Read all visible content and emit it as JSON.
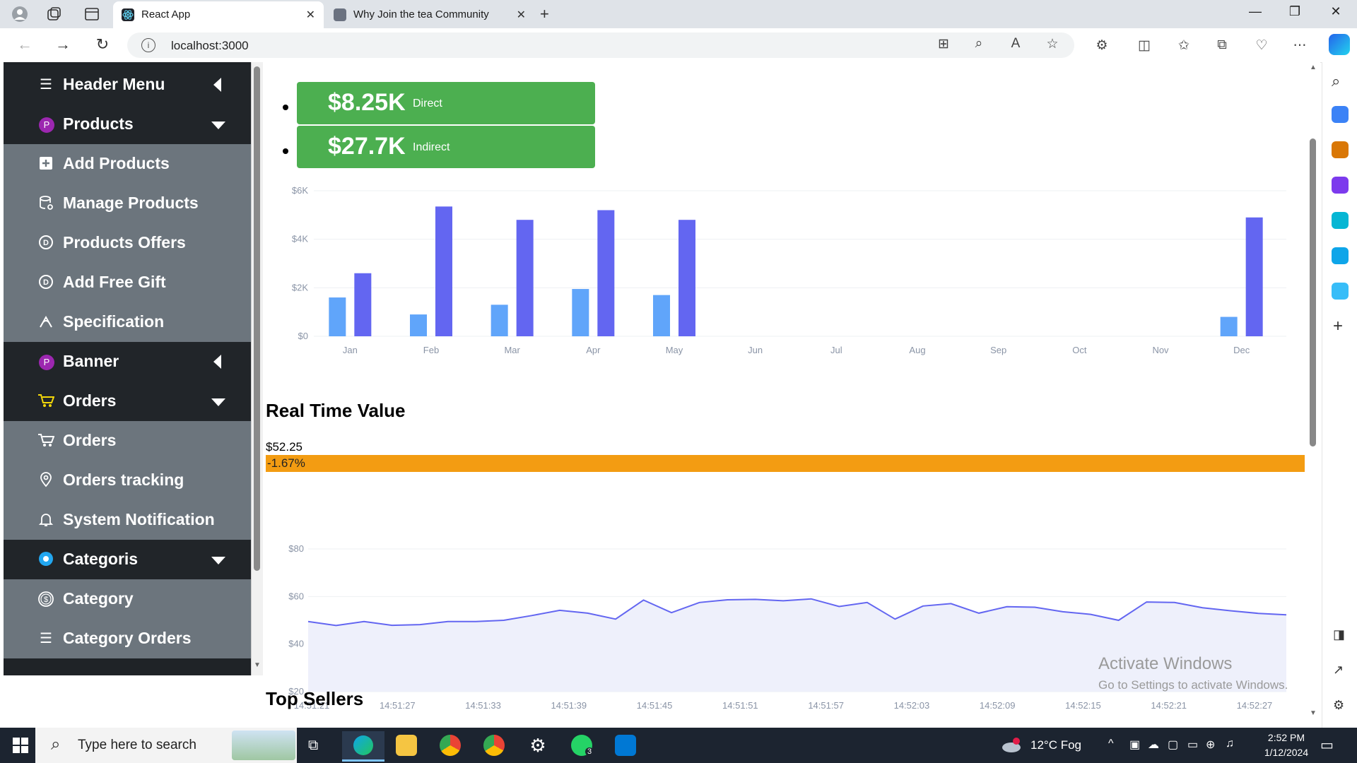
{
  "browser": {
    "tabs": [
      {
        "label": "React App",
        "active": true
      },
      {
        "label": "Why Join the tea Community",
        "active": false
      }
    ],
    "url": "localhost:3000"
  },
  "sidebar": {
    "header": "Header Menu",
    "sections": [
      {
        "label": "Products",
        "icon": "badge-p-icon",
        "expanded": true,
        "items": [
          {
            "label": "Add Products",
            "icon": "plus-square-icon"
          },
          {
            "label": "Manage Products",
            "icon": "database-gear-icon"
          },
          {
            "label": "Products Offers",
            "icon": "discount-circle-icon"
          },
          {
            "label": "Add Free Gift",
            "icon": "discount-circle-icon"
          },
          {
            "label": "Specification",
            "icon": "tools-icon"
          }
        ]
      },
      {
        "label": "Banner",
        "icon": "badge-p-icon",
        "expanded": false,
        "items": []
      },
      {
        "label": "Orders",
        "icon": "cart-icon",
        "expanded": true,
        "items": [
          {
            "label": "Orders",
            "icon": "cart-icon"
          },
          {
            "label": "Orders tracking",
            "icon": "location-pin-icon"
          },
          {
            "label": "System Notification",
            "icon": "bell-icon"
          }
        ]
      },
      {
        "label": "Categoris",
        "icon": "circle-c-icon",
        "expanded": true,
        "items": [
          {
            "label": "Category",
            "icon": "dollar-circle-icon"
          },
          {
            "label": "Category Orders",
            "icon": "list-icon"
          }
        ]
      }
    ]
  },
  "stats": [
    {
      "value": "$8.25K",
      "label": "Direct"
    },
    {
      "value": "$27.7K",
      "label": "Indirect"
    }
  ],
  "bar_chart_data": {
    "type": "bar",
    "categories": [
      "Jan",
      "Feb",
      "Mar",
      "Apr",
      "May",
      "Jun",
      "Jul",
      "Aug",
      "Sep",
      "Oct",
      "Nov",
      "Dec"
    ],
    "series": [
      {
        "values": [
          1600,
          900,
          1300,
          1950,
          1700,
          0,
          0,
          0,
          0,
          0,
          0,
          800
        ],
        "color": "#60a5fa"
      },
      {
        "values": [
          2600,
          5350,
          4800,
          5200,
          4800,
          0,
          0,
          0,
          0,
          0,
          0,
          4900
        ],
        "color": "#6366f1"
      }
    ],
    "yticks": [
      "$0",
      "$2K",
      "$4K",
      "$6K"
    ],
    "ylim": [
      0,
      6000
    ]
  },
  "realtime": {
    "title": "Real Time Value",
    "price": "$52.25",
    "change": "-1.67%",
    "change_color": "#f39c12"
  },
  "chart_data": {
    "type": "area",
    "x": [
      "14:51:21",
      "14:51:27",
      "14:51:33",
      "14:51:39",
      "14:51:45",
      "14:51:51",
      "14:51:57",
      "14:52:03",
      "14:52:09",
      "14:52:15",
      "14:52:21",
      "14:52:27"
    ],
    "values": [
      49.5,
      47.8,
      49.5,
      47.9,
      48.2,
      49.5,
      49.5,
      50.0,
      52.0,
      54.2,
      53.0,
      50.5,
      58.5,
      53.2,
      57.5,
      58.6,
      58.8,
      58.2,
      59.0,
      55.8,
      57.5,
      50.5,
      56.0,
      57.0,
      53.0,
      55.7,
      55.5,
      53.6,
      52.5,
      50.0,
      57.7,
      57.5,
      55.3,
      54.0,
      52.9,
      52.3
    ],
    "yticks": [
      "$20",
      "$40",
      "$60",
      "$80"
    ],
    "ylim": [
      20,
      80
    ],
    "color": "#6366f1"
  },
  "top_sellers": "Top Sellers",
  "watermark": {
    "line1": "Activate Windows",
    "line2": "Go to Settings to activate Windows."
  },
  "taskbar": {
    "search_placeholder": "Type here to search",
    "weather": "12°C  Fog",
    "time": "2:52 PM",
    "date": "1/12/2024",
    "whatsapp_badge": "3"
  }
}
